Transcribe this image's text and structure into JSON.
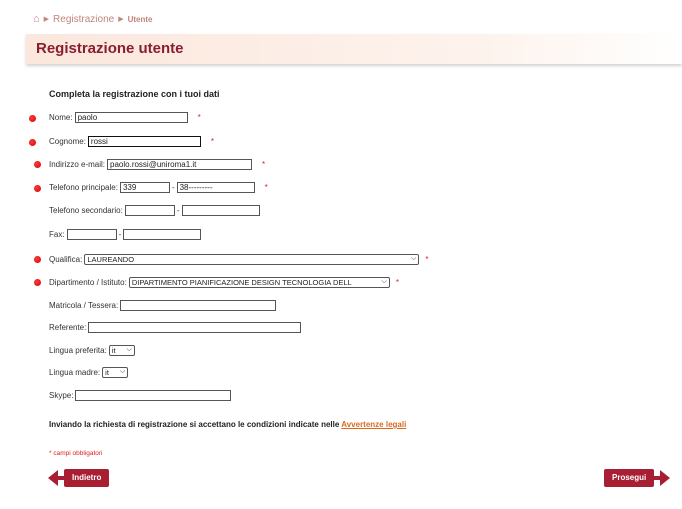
{
  "breadcrumb": {
    "home_icon": "home-icon",
    "items": [
      "Registrazione",
      "Utente"
    ]
  },
  "page_title": "Registrazione utente",
  "intro": "Completa la registrazione con i tuoi dati",
  "fields": {
    "nome": {
      "label": "Nome:",
      "value": "paolo",
      "required": "*"
    },
    "cognome": {
      "label": "Cognome:",
      "value": "rossi",
      "required": "*"
    },
    "email": {
      "label": "Indirizzo e-mail:",
      "value": "paolo.rossi@uniroma1.it",
      "required": "*"
    },
    "tel1": {
      "label": "Telefono principale:",
      "prefix": "339",
      "number": "38---------",
      "required": "*"
    },
    "tel2": {
      "label": "Telefono secondario:",
      "prefix": "",
      "number": ""
    },
    "fax": {
      "label": "Fax:",
      "prefix": "",
      "number": ""
    },
    "qualifica": {
      "label": "Qualifica:",
      "value": "LAUREANDO",
      "required": "*"
    },
    "dipartimento": {
      "label": "Dipartimento / Istituto:",
      "value": "DIPARTIMENTO PIANIFICAZIONE DESIGN TECNOLOGIA DELL",
      "required": "*"
    },
    "matricola": {
      "label": "Matricola / Tessera:",
      "value": ""
    },
    "referente": {
      "label": "Referente:",
      "value": ""
    },
    "lingua_pref": {
      "label": "Lingua preferita:",
      "value": "it"
    },
    "lingua_madre": {
      "label": "Lingua madre:",
      "value": "it"
    },
    "skype": {
      "label": "Skype:",
      "value": ""
    }
  },
  "notice": {
    "text": "Inviando la richiesta di registrazione si accettano le condizioni indicate nelle ",
    "link": "Avvertenze legali"
  },
  "footnote": "* campi obbligatori",
  "buttons": {
    "back": "Indietro",
    "next": "Prosegui"
  },
  "colors": {
    "brand": "#a81e32",
    "title": "#8a1e2e",
    "link": "#d86a1e",
    "required": "#e02020"
  }
}
